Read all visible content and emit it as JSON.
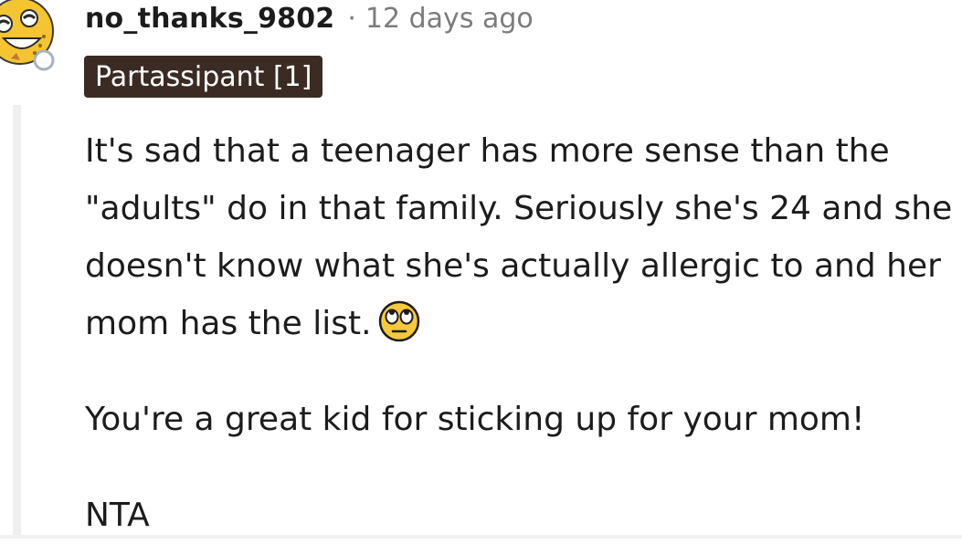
{
  "comment": {
    "username": "no_thanks_9802",
    "separator": "·",
    "timestamp": "12 days ago",
    "flair": "Partassipant [1]",
    "paragraphs": [
      "It's sad that a teenager has more sense than the \"adults\" do in that family. Seriously she's 24 and she doesn't know what she's actually allergic to and her mom has the list.",
      "You're a great kid for sticking up for your mom!",
      "NTA"
    ],
    "avatar_icon": "laughing-snoovatar-icon",
    "emoji_icon": "eye-roll-emoji-icon"
  },
  "colors": {
    "text": "#1c1c1c",
    "meta": "#7c7c7c",
    "flair_bg": "#3b2b22",
    "flair_text": "#ffffff",
    "thread_line": "#edeff1",
    "avatar_yellow": "#f4c531",
    "emoji_yellow": "#f7c93a"
  }
}
